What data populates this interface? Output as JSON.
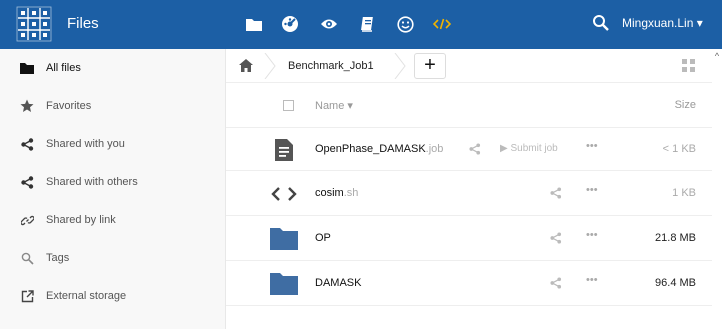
{
  "header": {
    "app_name": "Files",
    "user": "Mingxuan.Lin ▾",
    "apps": [
      "files-icon",
      "dashboard-icon",
      "eye-icon",
      "notebook-icon",
      "smiley-icon",
      "code-icon"
    ],
    "brand_color": "#1c5fa5"
  },
  "sidebar": {
    "items": [
      {
        "label": "All files",
        "icon": "folder-icon"
      },
      {
        "label": "Favorites",
        "icon": "star-icon"
      },
      {
        "label": "Shared with you",
        "icon": "share-icon"
      },
      {
        "label": "Shared with others",
        "icon": "share-icon"
      },
      {
        "label": "Shared by link",
        "icon": "link-icon"
      },
      {
        "label": "Tags",
        "icon": "tag-search-icon"
      },
      {
        "label": "External storage",
        "icon": "external-storage-icon"
      }
    ]
  },
  "breadcrumb": {
    "current": "Benchmark_Job1"
  },
  "controls": {
    "add_label": "+"
  },
  "table": {
    "headers": {
      "name": "Name ▾",
      "size": "Size"
    },
    "rows": [
      {
        "name": "OpenPhase_DAMASK",
        "ext": ".job",
        "size": "< 1 KB",
        "action": "▶ Submit job",
        "icon": "document-icon"
      },
      {
        "name": "cosim",
        "ext": ".sh",
        "size": "1 KB",
        "action": "",
        "icon": "code-file-icon"
      },
      {
        "name": "OP",
        "ext": "",
        "size": "21.8 MB",
        "action": "",
        "icon": "folder-icon"
      },
      {
        "name": "DAMASK",
        "ext": "",
        "size": "96.4 MB",
        "action": "",
        "icon": "folder-icon"
      }
    ],
    "more_label": "•••"
  }
}
